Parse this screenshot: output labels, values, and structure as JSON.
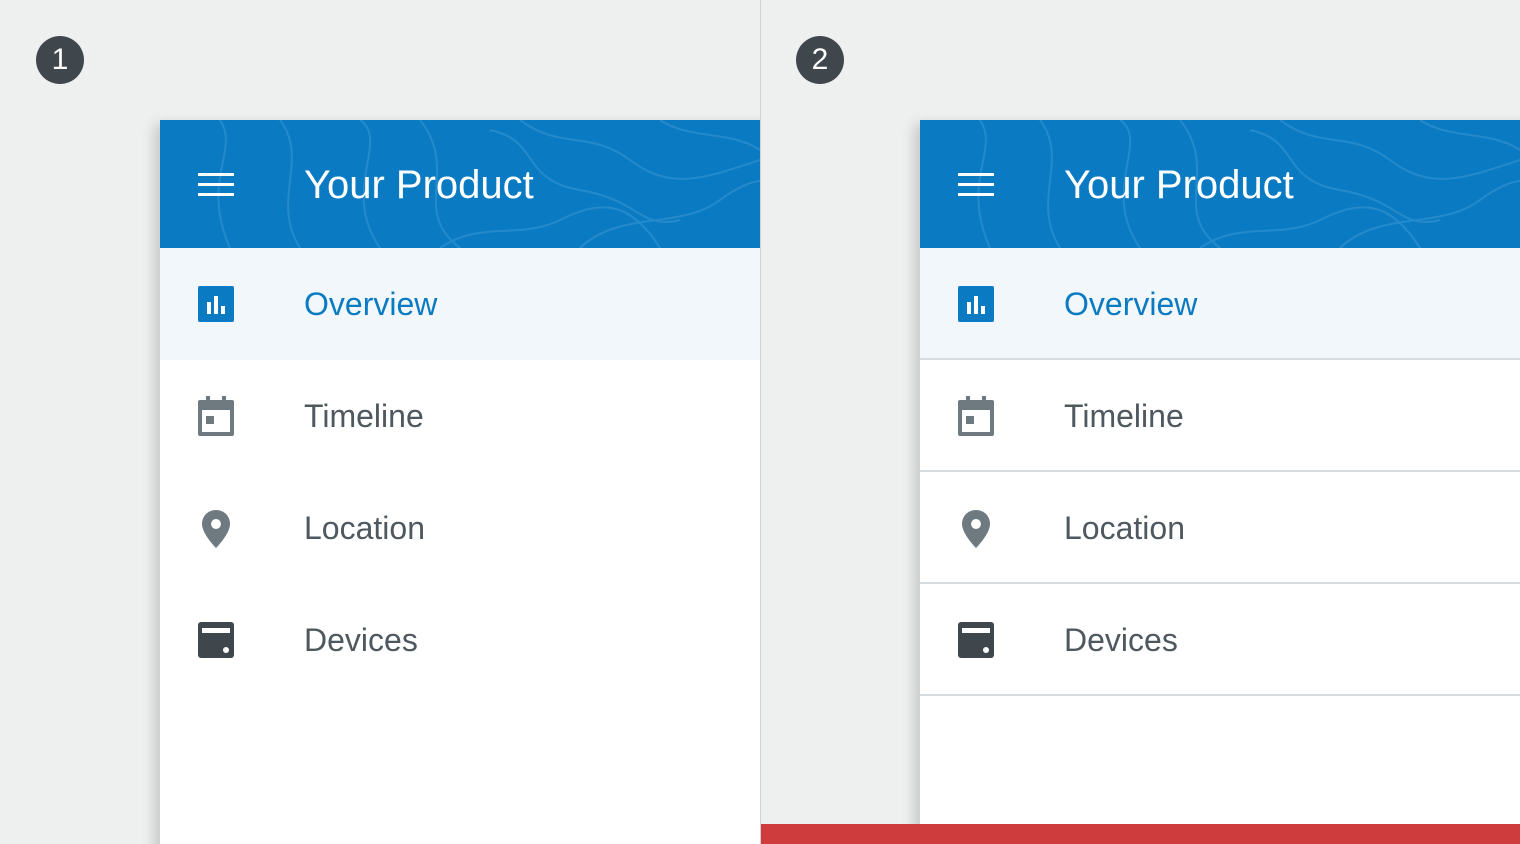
{
  "panels": [
    {
      "badge": "1",
      "header": {
        "title": "Your Product"
      },
      "items": [
        {
          "label": "Overview",
          "icon": "bar-chart-icon",
          "active": true
        },
        {
          "label": "Timeline",
          "icon": "calendar-icon"
        },
        {
          "label": "Location",
          "icon": "location-pin-icon"
        },
        {
          "label": "Devices",
          "icon": "device-icon"
        }
      ]
    },
    {
      "badge": "2",
      "header": {
        "title": "Your Product"
      },
      "items": [
        {
          "label": "Overview",
          "icon": "bar-chart-icon",
          "active": true
        },
        {
          "label": "Timeline",
          "icon": "calendar-icon"
        },
        {
          "label": "Location",
          "icon": "location-pin-icon"
        },
        {
          "label": "Devices",
          "icon": "device-icon"
        }
      ]
    }
  ],
  "colors": {
    "brand": "#0a7bc2",
    "active_bg": "#f2f7fb",
    "text": "#4e585f",
    "icon": "#6f7a80",
    "badge": "#3f474d",
    "alert_bar": "#cf3c3e"
  }
}
